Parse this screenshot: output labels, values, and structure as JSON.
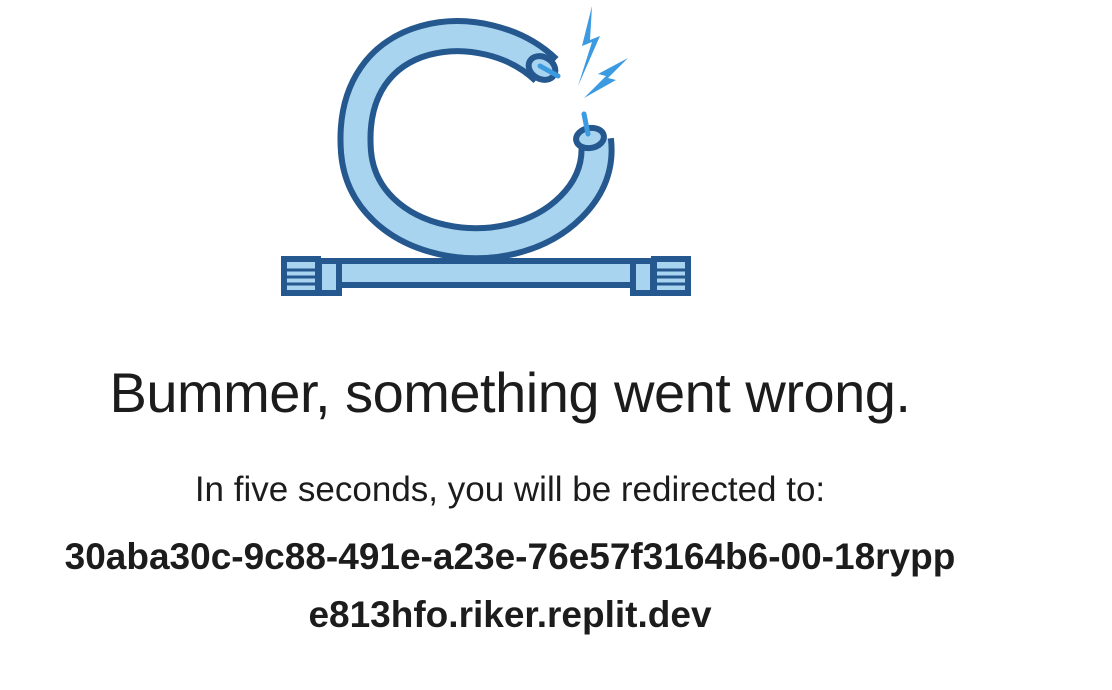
{
  "page": {
    "heading": "Bummer, something went wrong.",
    "message": "In five seconds, you will be redirected to:",
    "redirect_target": "30aba30c-9c88-491e-a23e-76e57f3164b6-00-18ryppe813hfo.riker.replit.dev"
  },
  "illustration": {
    "icon": "broken-cable-icon",
    "spark_icon": "lightning-bolt-icon",
    "colors": {
      "outline": "#24588f",
      "fill": "#a9d4f0",
      "spark": "#3b9ae0"
    }
  }
}
